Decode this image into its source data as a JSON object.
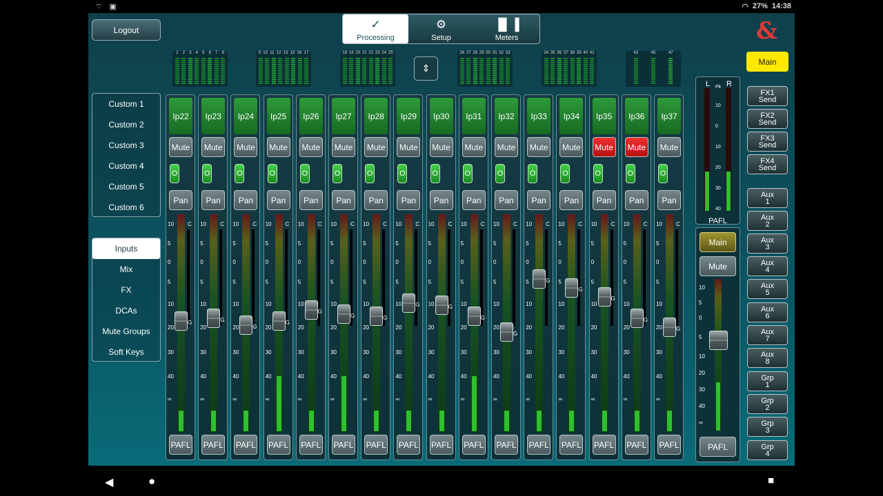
{
  "status_bar": {
    "battery": "27%",
    "time": "14:38"
  },
  "header": {
    "logout_label": "Logout",
    "tabs": [
      {
        "label": "Processing",
        "icon": "processing-icon",
        "active": true
      },
      {
        "label": "Setup",
        "icon": "gear-icon",
        "active": false
      },
      {
        "label": "Meters",
        "icon": "meters-icon",
        "active": false
      }
    ],
    "logo": "&"
  },
  "custom_menu": [
    "Custom 1",
    "Custom 2",
    "Custom 3",
    "Custom 4",
    "Custom 5",
    "Custom 6"
  ],
  "nav_menu": [
    {
      "label": "Inputs",
      "active": true
    },
    {
      "label": "Mix",
      "active": false
    },
    {
      "label": "FX",
      "active": false
    },
    {
      "label": "DCAs",
      "active": false
    },
    {
      "label": "Mute Groups",
      "active": false
    },
    {
      "label": "Soft Keys",
      "active": false
    }
  ],
  "meter_banks": [
    {
      "nums": [
        "1",
        "2",
        "3",
        "4",
        "5",
        "6",
        "7",
        "8"
      ]
    },
    {
      "nums": [
        "9",
        "10",
        "11",
        "12",
        "13",
        "15",
        "16",
        "17"
      ]
    },
    {
      "nums": [
        "18",
        "19",
        "20",
        "21",
        "22",
        "23",
        "24",
        "25"
      ]
    },
    {
      "nums": [
        "26",
        "27",
        "28",
        "29",
        "30",
        "31",
        "32",
        "33"
      ]
    },
    {
      "nums": [
        "34",
        "35",
        "36",
        "37",
        "38",
        "39",
        "40",
        "41"
      ]
    },
    {
      "nums": [
        "43",
        "45",
        "47"
      ]
    }
  ],
  "fader_scale": [
    "10",
    "5",
    "0",
    "5",
    "10",
    "20",
    "30",
    "40",
    "∞"
  ],
  "scale_clip": "C",
  "scale_gate": "G",
  "channels": [
    {
      "name": "Ip22",
      "mute": false,
      "on": "O",
      "pan": "Pan",
      "pafl": "PAFL",
      "level": 0.12,
      "fader": 0.55
    },
    {
      "name": "Ip23",
      "mute": false,
      "on": "O",
      "pan": "Pan",
      "pafl": "PAFL",
      "level": 0.12,
      "fader": 0.56
    },
    {
      "name": "Ip24",
      "mute": false,
      "on": "O",
      "pan": "Pan",
      "pafl": "PAFL",
      "level": 0.12,
      "fader": 0.53
    },
    {
      "name": "Ip25",
      "mute": false,
      "on": "O",
      "pan": "Pan",
      "pafl": "PAFL",
      "level": 0.32,
      "fader": 0.55
    },
    {
      "name": "Ip26",
      "mute": false,
      "on": "O",
      "pan": "Pan",
      "pafl": "PAFL",
      "level": 0.12,
      "fader": 0.6
    },
    {
      "name": "Ip27",
      "mute": false,
      "on": "O",
      "pan": "Pan",
      "pafl": "PAFL",
      "level": 0.32,
      "fader": 0.58
    },
    {
      "name": "Ip28",
      "mute": false,
      "on": "O",
      "pan": "Pan",
      "pafl": "PAFL",
      "level": 0.12,
      "fader": 0.57
    },
    {
      "name": "Ip29",
      "mute": false,
      "on": "O",
      "pan": "Pan",
      "pafl": "PAFL",
      "level": 0.12,
      "fader": 0.63
    },
    {
      "name": "Ip30",
      "mute": false,
      "on": "O",
      "pan": "Pan",
      "pafl": "PAFL",
      "level": 0.12,
      "fader": 0.62
    },
    {
      "name": "Ip31",
      "mute": false,
      "on": "O",
      "pan": "Pan",
      "pafl": "PAFL",
      "level": 0.32,
      "fader": 0.57
    },
    {
      "name": "Ip32",
      "mute": false,
      "on": "O",
      "pan": "Pan",
      "pafl": "PAFL",
      "level": 0.12,
      "fader": 0.5
    },
    {
      "name": "Ip33",
      "mute": false,
      "on": "O",
      "pan": "Pan",
      "pafl": "PAFL",
      "level": 0.12,
      "fader": 0.74
    },
    {
      "name": "Ip34",
      "mute": false,
      "on": "O",
      "pan": "Pan",
      "pafl": "PAFL",
      "level": 0.12,
      "fader": 0.7
    },
    {
      "name": "Ip35",
      "mute": true,
      "on": "O",
      "pan": "Pan",
      "pafl": "PAFL",
      "level": 0.12,
      "fader": 0.66
    },
    {
      "name": "Ip36",
      "mute": true,
      "on": "O",
      "pan": "Pan",
      "pafl": "PAFL",
      "level": 0.12,
      "fader": 0.56
    },
    {
      "name": "Ip37",
      "mute": false,
      "on": "O",
      "pan": "Pan",
      "pafl": "PAFL",
      "level": 0.12,
      "fader": 0.52
    }
  ],
  "master": {
    "left_label": "L",
    "right_label": "R",
    "peak_label": "Pk",
    "meter_scale": [
      "10",
      "0",
      "10",
      "20",
      "30",
      "40"
    ],
    "meter_pafl": "PAFL",
    "main_label": "Main",
    "mute_label": "Mute",
    "pafl_label": "PAFL",
    "fader_scale": [
      "10",
      "5",
      "0",
      "5",
      "10",
      "20",
      "30",
      "40",
      "∞"
    ],
    "level_l": 0.32,
    "level_r": 0.32
  },
  "mix_select": {
    "main": "Main",
    "buttons": [
      "FX1\nSend",
      "FX2\nSend",
      "FX3\nSend",
      "FX4\nSend",
      "Aux\n1",
      "Aux\n2",
      "Aux\n3",
      "Aux\n4",
      "Aux\n5",
      "Aux\n6",
      "Aux\n7",
      "Aux\n8",
      "Grp\n1",
      "Grp\n2",
      "Grp\n3",
      "Grp\n4"
    ]
  },
  "nav": {
    "back": "◀",
    "home": "●",
    "recents": "■"
  }
}
